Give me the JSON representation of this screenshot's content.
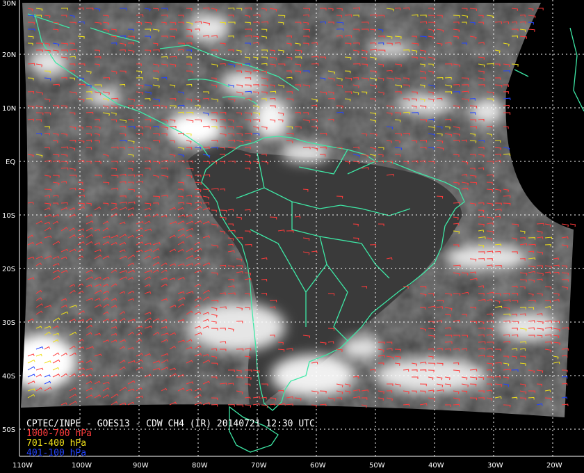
{
  "map": {
    "latitude_labels": [
      "30N",
      "20N",
      "10N",
      "EQ",
      "10S",
      "20S",
      "30S",
      "40S",
      "50S"
    ],
    "longitude_labels": [
      "110W",
      "100W",
      "90W",
      "80W",
      "70W",
      "60W",
      "50W",
      "40W",
      "30W",
      "20W"
    ],
    "colors": {
      "background": "#000000",
      "coastline": "#3ee8a6",
      "grid": "#ffffff",
      "low_level": "#ff3b3b",
      "mid_level": "#f0e01a",
      "high_level": "#2244ff"
    }
  },
  "caption": {
    "title": "CPTEC/INPE - GOES13 - CDW CH4 (IR) 20140721 12:30 UTC",
    "legend": [
      {
        "label": "1000-700 hPa",
        "color": "#ff3b3b"
      },
      {
        "label": "701-400 hPa",
        "color": "#f0e01a"
      },
      {
        "label": "401-100 hPa",
        "color": "#2244ff"
      }
    ]
  }
}
